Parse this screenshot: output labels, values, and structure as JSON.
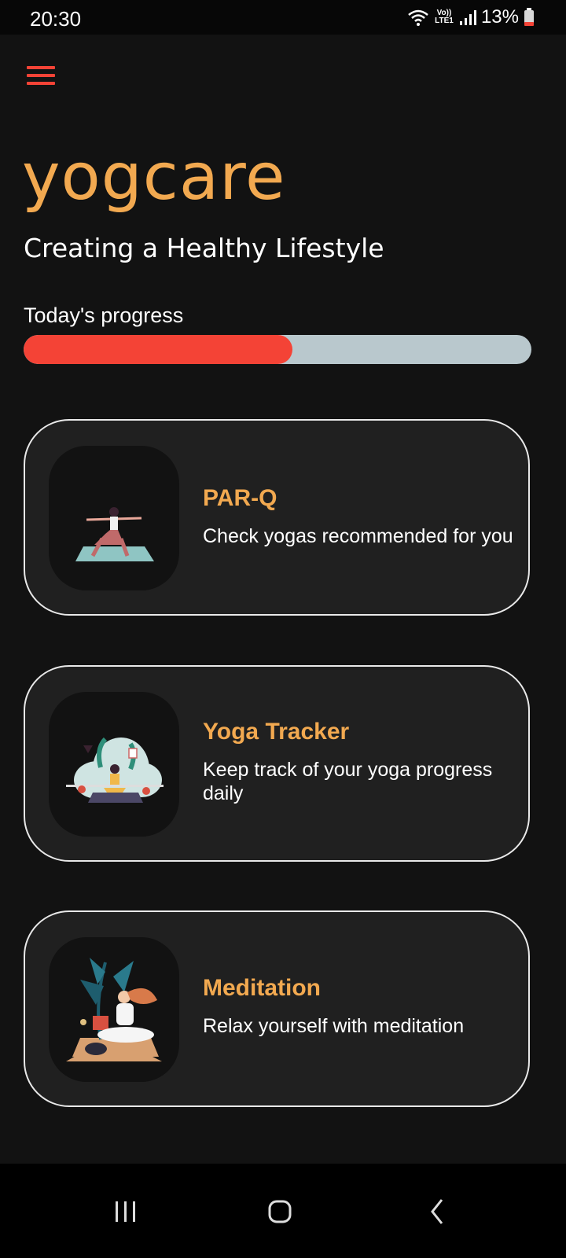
{
  "status_bar": {
    "time": "20:30",
    "network": "Vo)) LTE1",
    "battery": "13%"
  },
  "header": {
    "menu_icon": "hamburger-menu-icon",
    "brand": "yogcare",
    "tagline": "Creating a Healthy Lifestyle"
  },
  "progress": {
    "label": "Today's progress",
    "value_fraction": 0.53
  },
  "cards": [
    {
      "title": "PAR-Q",
      "description": "Check yogas recommended for you",
      "image": "warrior-pose-illustration"
    },
    {
      "title": "Yoga Tracker",
      "description": "Keep track of your yoga progress daily",
      "image": "seated-yoga-plants-illustration"
    },
    {
      "title": "Meditation",
      "description": "Relax yourself with meditation",
      "image": "meditating-woman-illustration"
    }
  ],
  "nav_bar": {
    "recents_icon": "recents-icon",
    "home_icon": "home-icon",
    "back_icon": "back-icon"
  },
  "colors": {
    "accent": "#f2a950",
    "progress_fill": "#f44336",
    "progress_track": "#b9c8cd",
    "background": "#121212",
    "card": "#202020"
  }
}
